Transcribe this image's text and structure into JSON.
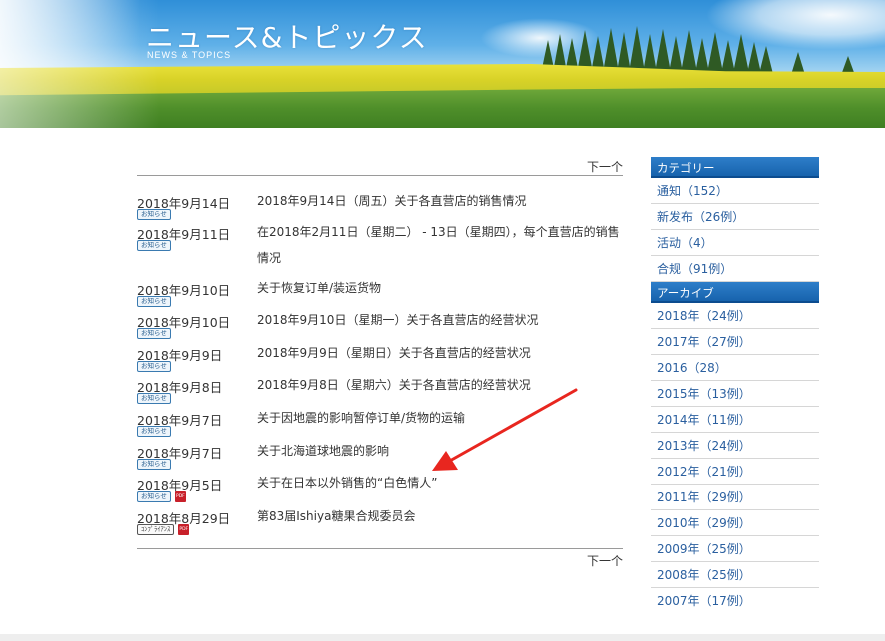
{
  "header": {
    "title": "ニュース&トピックス",
    "subtitle": "NEWS & TOPICS"
  },
  "pager": {
    "next_label": "下一个"
  },
  "news": [
    {
      "date": "2018年9月14日",
      "badges": [
        "お知らせ"
      ],
      "pdf": false,
      "title": "2018年9月14日（周五）关于各直营店的销售情况"
    },
    {
      "date": "2018年9月11日",
      "badges": [
        "お知らせ"
      ],
      "pdf": false,
      "title": "在2018年2月11日（星期二） - 13日（星期四），每个直营店的销售情况"
    },
    {
      "date": "2018年9月10日",
      "badges": [
        "お知らせ"
      ],
      "pdf": false,
      "title": "关于恢复订单/装运货物"
    },
    {
      "date": "2018年9月10日",
      "badges": [
        "お知らせ"
      ],
      "pdf": false,
      "title": "2018年9月10日（星期一）关于各直营店的经营状况"
    },
    {
      "date": "2018年9月9日",
      "badges": [
        "お知らせ"
      ],
      "pdf": false,
      "title": "2018年9月9日（星期日）关于各直营店的经营状况"
    },
    {
      "date": "2018年9月8日",
      "badges": [
        "お知らせ"
      ],
      "pdf": false,
      "title": "2018年9月8日（星期六）关于各直营店的经营状况"
    },
    {
      "date": "2018年9月7日",
      "badges": [
        "お知らせ"
      ],
      "pdf": false,
      "title": "关于因地震的影响暂停订单/货物的运输"
    },
    {
      "date": "2018年9月7日",
      "badges": [
        "お知らせ"
      ],
      "pdf": false,
      "title": "关于北海道球地震的影响"
    },
    {
      "date": "2018年9月5日",
      "badges": [
        "お知らせ"
      ],
      "pdf": true,
      "title": "关于在日本以外销售的“白色情人”"
    },
    {
      "date": "2018年8月29日",
      "badges": [
        "ｺﾝﾌﾟﾗｲｱﾝｽ"
      ],
      "pdf": true,
      "title": "第83届Ishiya糖果合规委员会"
    }
  ],
  "pdf_icon_label": "PDF",
  "sidebar": {
    "category_heading": "カテゴリー",
    "categories": [
      {
        "label": "通知（152）"
      },
      {
        "label": "新发布（26例）"
      },
      {
        "label": "活动（4）"
      },
      {
        "label": "合规（91例）"
      }
    ],
    "archive_heading": "アーカイブ",
    "archives": [
      {
        "label": "2018年（24例）"
      },
      {
        "label": "2017年（27例）"
      },
      {
        "label": "2016（28）"
      },
      {
        "label": "2015年（13例）"
      },
      {
        "label": "2014年（11例）"
      },
      {
        "label": "2013年（24例）"
      },
      {
        "label": "2012年（21例）"
      },
      {
        "label": "2011年（29例）"
      },
      {
        "label": "2010年（29例）"
      },
      {
        "label": "2009年（25例）"
      },
      {
        "label": "2008年（25例）"
      },
      {
        "label": "2007年（17例）"
      }
    ]
  },
  "colors": {
    "sidebar_heading": "#1763ad",
    "sidebar_link": "#2a5f9f",
    "annotation_arrow": "#e8261f",
    "pdf_icon": "#c8202a"
  }
}
